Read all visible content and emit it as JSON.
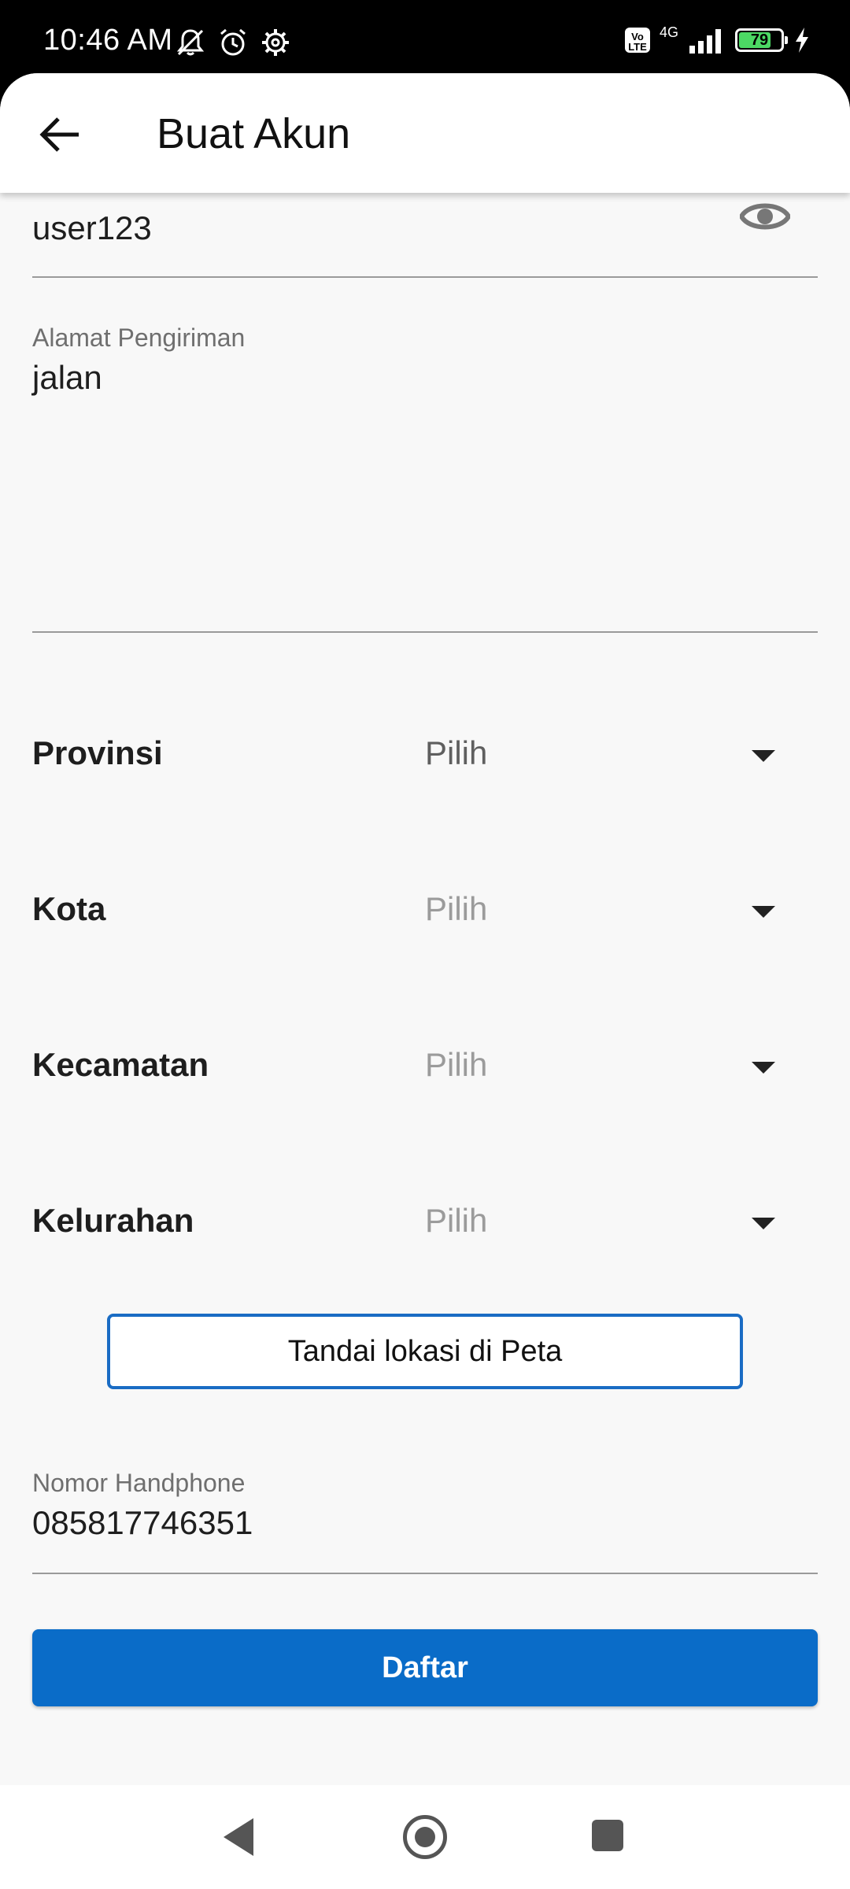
{
  "status_bar": {
    "time": "10:46 AM",
    "network": "4G",
    "volte": "Vo LTE",
    "battery_percent": "79",
    "battery_level": 0.79,
    "icons": [
      "mute-icon",
      "alarm-icon",
      "settings-icon",
      "signal-icon",
      "battery-icon",
      "charging-icon"
    ]
  },
  "app_bar": {
    "title": "Buat Akun",
    "back_icon": "arrow-left-icon"
  },
  "form": {
    "password_value": "user123",
    "address_label": "Alamat Pengiriman",
    "address_value": "jalan",
    "dropdowns": [
      {
        "label": "Provinsi",
        "value": "Pilih"
      },
      {
        "label": "Kota",
        "value": "Pilih"
      },
      {
        "label": "Kecamatan",
        "value": "Pilih"
      },
      {
        "label": "Kelurahan",
        "value": "Pilih"
      }
    ],
    "map_button_label": "Tandai lokasi di Peta",
    "phone_label": "Nomor Handphone",
    "phone_value": "085817746351",
    "submit_label": "Daftar"
  },
  "colors": {
    "primary": "#0a6cc8",
    "outline_button_border": "#1a6cc4",
    "dropdown_active_text": "#5f5f5f",
    "dropdown_disabled_text": "#9b9b9b"
  }
}
